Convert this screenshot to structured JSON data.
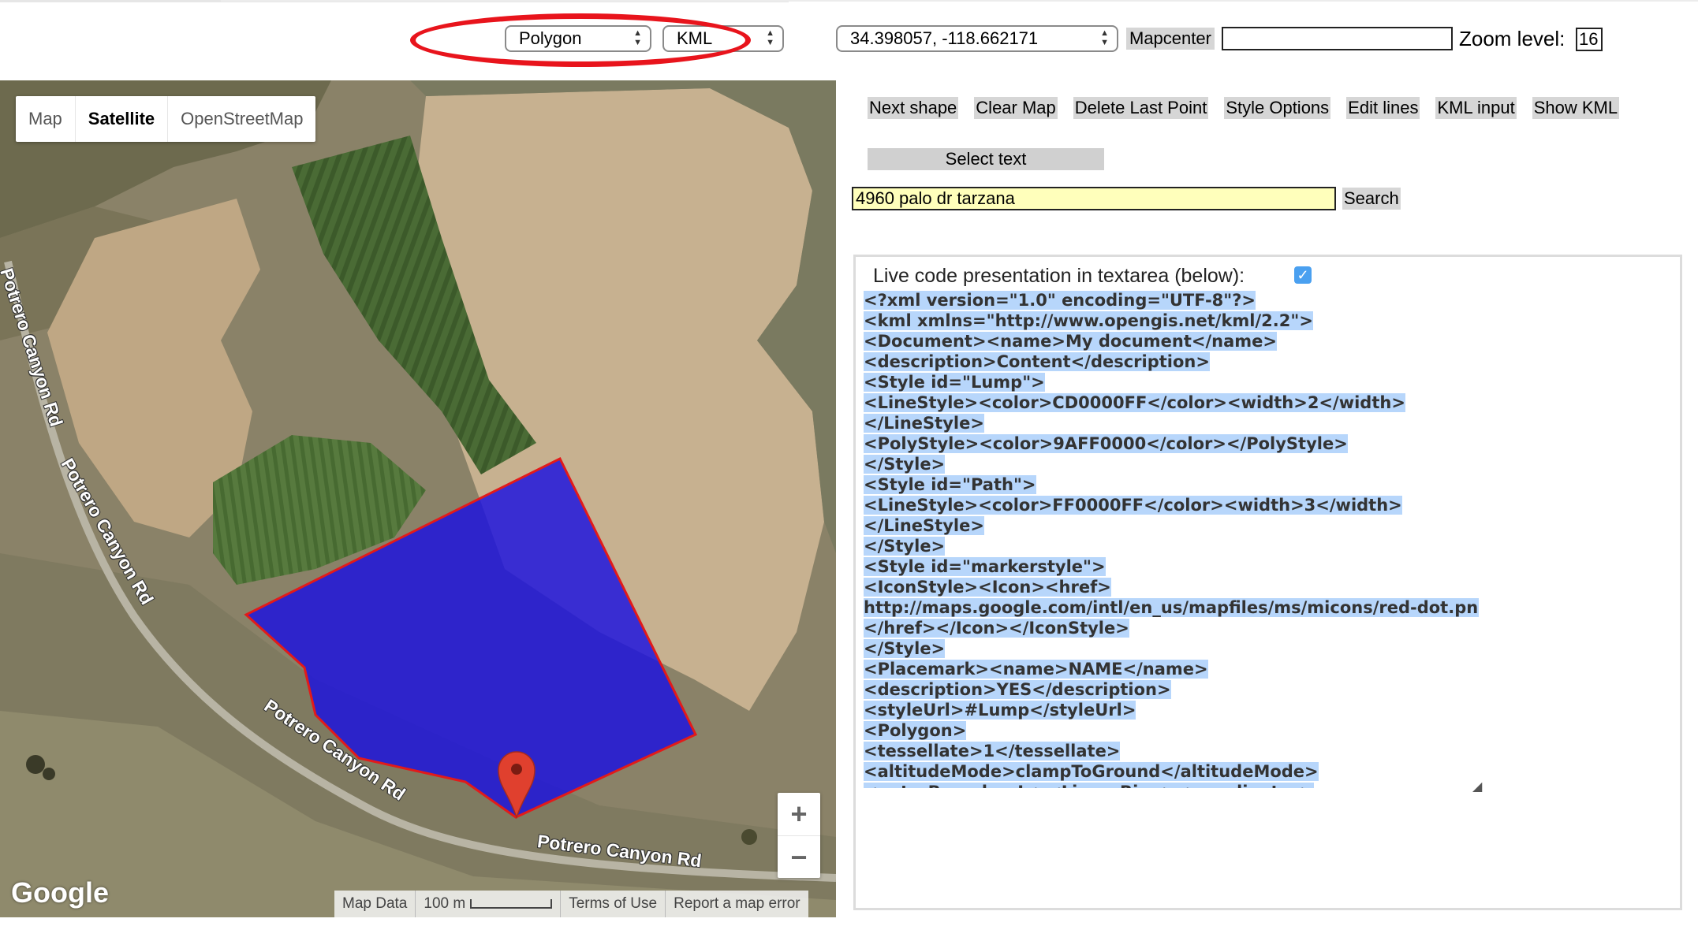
{
  "toolbar": {
    "shape_select": "Polygon",
    "format_select": "KML",
    "coordinates": "34.398057, -118.662171",
    "mapcenter_label": "Mapcenter",
    "mapcenter_value": "",
    "zoom_label": "Zoom level:",
    "zoom_value": "16"
  },
  "map": {
    "map_types": [
      "Map",
      "Satellite",
      "OpenStreetMap"
    ],
    "active_map_type": "Satellite",
    "road_labels": [
      "Potrero Canyon Rd",
      "Potrero Canyon Rd",
      "Potrero Canyon Rd",
      "Potrero Canyon Rd"
    ],
    "zoom_in": "+",
    "zoom_out": "−",
    "logo": "Google",
    "attribution": {
      "map_data": "Map Data",
      "scale": "100 m",
      "terms": "Terms of Use",
      "report": "Report a map error"
    },
    "colors": {
      "polygon_fill": "#1a10e0",
      "polygon_stroke": "#e21a1a",
      "marker": "#e0402e"
    }
  },
  "actions": {
    "buttons": [
      "Next shape",
      "Clear Map",
      "Delete Last Point",
      "Style Options",
      "Edit lines",
      "KML input",
      "Show KML"
    ],
    "select_text": "Select text",
    "search_value": "4960 palo dr tarzana",
    "search_button": "Search"
  },
  "code_panel": {
    "label": "Live code presentation in textarea (below):",
    "checked": true,
    "lines": [
      "<?xml version=\"1.0\" encoding=\"UTF-8\"?>",
      "<kml xmlns=\"http://www.opengis.net/kml/2.2\">",
      "<Document><name>My document</name>",
      "<description>Content</description>",
      "<Style id=\"Lump\">",
      "<LineStyle><color>CD0000FF</color><width>2</width>",
      "</LineStyle>",
      "<PolyStyle><color>9AFF0000</color></PolyStyle>",
      "</Style>",
      "<Style id=\"Path\">",
      "<LineStyle><color>FF0000FF</color><width>3</width>",
      "</LineStyle>",
      "</Style>",
      "<Style id=\"markerstyle\">",
      "<IconStyle><Icon><href>",
      "http://maps.google.com/intl/en_us/mapfiles/ms/micons/red-dot.png",
      "</href></Icon></IconStyle>",
      "</Style>",
      "<Placemark><name>NAME</name>",
      "<description>YES</description>",
      "<styleUrl>#Lump</styleUrl>",
      "<Polygon>",
      "<tessellate>1</tessellate>",
      "<altitudeMode>clampToGround</altitudeMode>",
      "<outerBoundaryIs><LinearRing><coordinates>"
    ]
  }
}
